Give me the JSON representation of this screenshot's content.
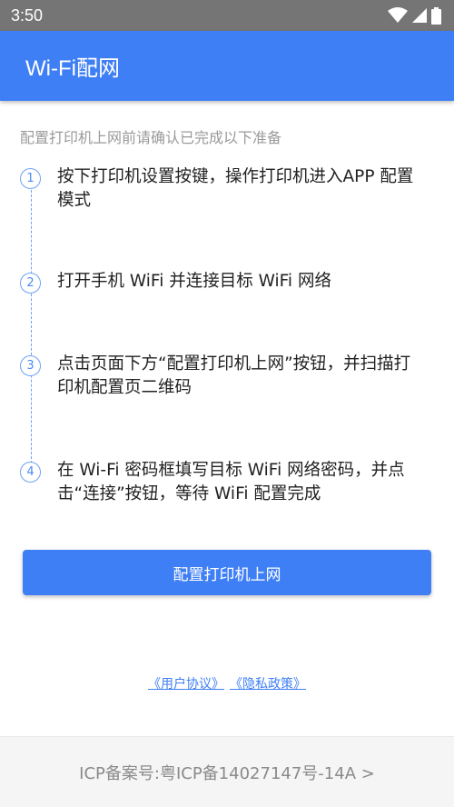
{
  "status_bar": {
    "time": "3:50"
  },
  "app_bar": {
    "title": "Wi-Fi配网"
  },
  "intro": "配置打印机上网前请确认已完成以下准备",
  "steps": [
    {
      "number": "1",
      "text": "按下打印机设置按键，操作打印机进入APP 配置模式"
    },
    {
      "number": "2",
      "text": "打开手机 WiFi 并连接目标 WiFi 网络"
    },
    {
      "number": "3",
      "text": "点击页面下方“配置打印机上网”按钮，并扫描打印机配置页二维码"
    },
    {
      "number": "4",
      "text": "在 Wi-Fi 密码框填写目标 WiFi 网络密码，并点击“连接”按钮，等待 WiFi 配置完成"
    }
  ],
  "primary_button": "配置打印机上网",
  "links": {
    "user_agreement": "《用户协议》",
    "privacy_policy": "《隐私政策》"
  },
  "footer": {
    "icp": "ICP备案号:粤ICP备14027147号-14A >"
  }
}
